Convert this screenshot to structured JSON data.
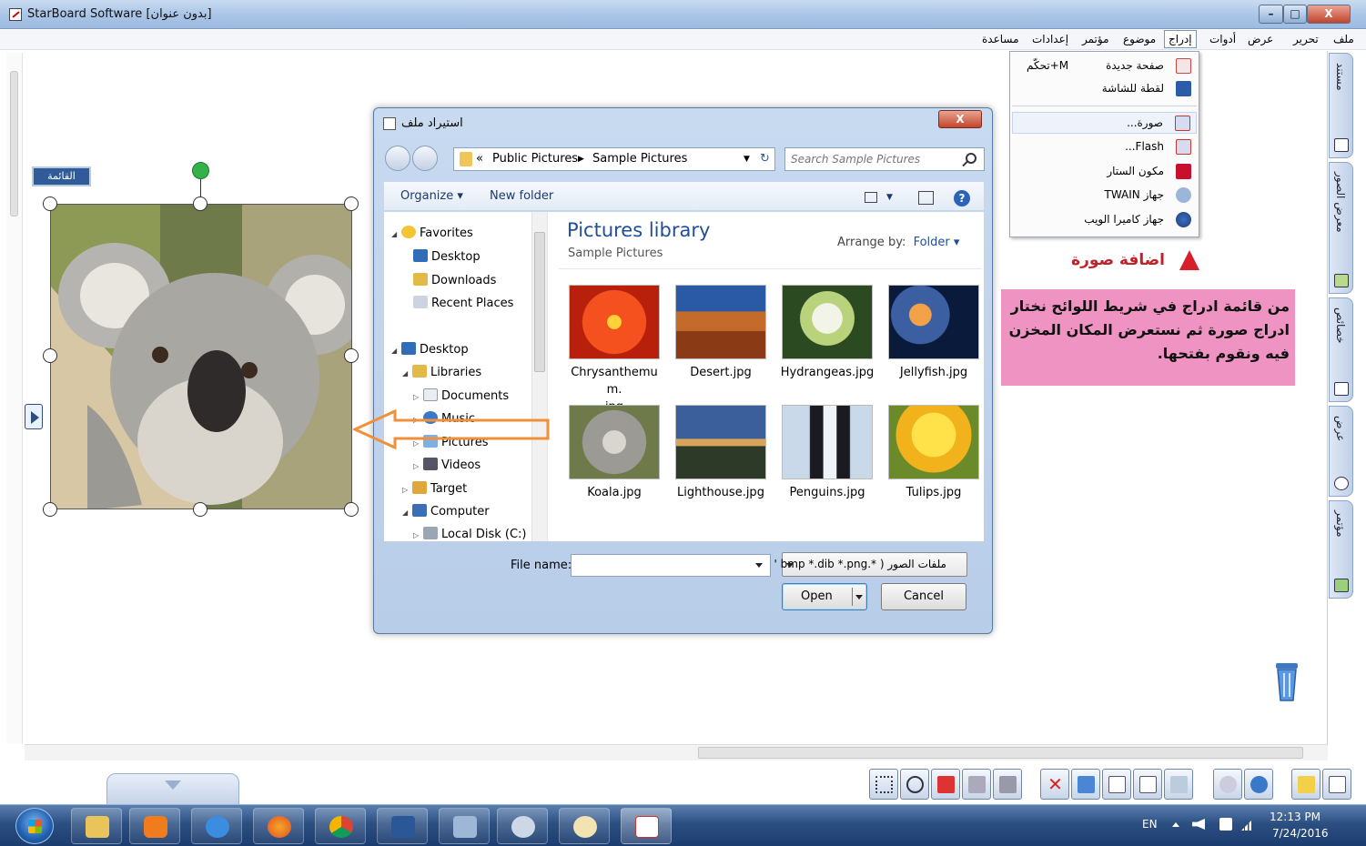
{
  "window": {
    "title": "StarBoard Software [بدون عنوان]",
    "controls": {
      "minimize": "–",
      "maximize": "□",
      "close": "X"
    }
  },
  "menubar": {
    "items": [
      "ملف",
      "تحرير",
      "عرض",
      "أدوات",
      "إدراج",
      "موضوع",
      "مؤتمر",
      "إعدادات",
      "مساعدة"
    ],
    "active": "إدراج"
  },
  "insert_menu": {
    "items": [
      {
        "label": "صفحة جديدة",
        "shortcut": "تحكّم+M",
        "icon": "new-page-icon"
      },
      {
        "label": "لقطة للشاشة",
        "shortcut": "",
        "icon": "screen-capture-icon"
      },
      {
        "label": "صورة...",
        "shortcut": "",
        "icon": "picture-icon",
        "highlighted": true
      },
      {
        "label": "Flash...",
        "shortcut": "",
        "icon": "flash-icon"
      },
      {
        "label": "مكون الستار",
        "shortcut": "",
        "icon": "star-component-icon"
      },
      {
        "label": "جهاز TWAIN",
        "shortcut": "",
        "icon": "twain-icon"
      },
      {
        "label": "جهاز كاميرا الويب",
        "shortcut": "",
        "icon": "webcam-icon"
      }
    ]
  },
  "annotation": {
    "caption": "اضافة صورة",
    "instruction_lines": [
      "من قائمة ادراج في شريط اللوائح نختار",
      "ادراج صورة ثم نستعرض المكان المخزن",
      "فيه ونقوم بفتحها."
    ]
  },
  "canvas": {
    "list_tab": "القائمة",
    "right_tabs": [
      "مستند",
      "معرض الصور",
      "خصائص",
      "عرض",
      "مؤتمر"
    ]
  },
  "dialog": {
    "title": "استيراد ملف",
    "close": "X",
    "breadcrumb": [
      "«",
      "Public Pictures",
      "Sample Pictures"
    ],
    "search_placeholder": "Search Sample Pictures",
    "toolbar": {
      "organize": "Organize ▾",
      "new_folder": "New folder"
    },
    "nav_tree": [
      {
        "label": "Favorites",
        "icon": "star-icon",
        "level": 0,
        "expander": "◢"
      },
      {
        "label": "Desktop",
        "icon": "desktop-icon",
        "level": 1,
        "expander": ""
      },
      {
        "label": "Downloads",
        "icon": "downloads-icon",
        "level": 1,
        "expander": ""
      },
      {
        "label": "Recent Places",
        "icon": "recent-places-icon",
        "level": 1,
        "expander": ""
      },
      {
        "label": "Desktop",
        "icon": "desktop-icon",
        "level": 0,
        "expander": "◢"
      },
      {
        "label": "Libraries",
        "icon": "libraries-icon",
        "level": 1,
        "expander": "◢"
      },
      {
        "label": "Documents",
        "icon": "documents-icon",
        "level": 2,
        "expander": "▷"
      },
      {
        "label": "Music",
        "icon": "music-icon",
        "level": 2,
        "expander": "▷"
      },
      {
        "label": "Pictures",
        "icon": "pictures-icon",
        "level": 2,
        "expander": "▷"
      },
      {
        "label": "Videos",
        "icon": "videos-icon",
        "level": 2,
        "expander": "▷"
      },
      {
        "label": "Target",
        "icon": "user-folder-icon",
        "level": 1,
        "expander": "▷"
      },
      {
        "label": "Computer",
        "icon": "computer-icon",
        "level": 1,
        "expander": "◢"
      },
      {
        "label": "Local Disk (C:)",
        "icon": "drive-icon",
        "level": 2,
        "expander": "▷"
      }
    ],
    "library": {
      "title": "Pictures library",
      "subtitle": "Sample Pictures",
      "arrange_label": "Arrange by:",
      "arrange_value": "Folder ▾"
    },
    "files": [
      {
        "name": "Chrysanthemum.jpg",
        "line1": "Chrysanthemum.",
        "line2": "jpg"
      },
      {
        "name": "Desert.jpg",
        "line1": "Desert.jpg",
        "line2": ""
      },
      {
        "name": "Hydrangeas.jpg",
        "line1": "Hydrangeas.jpg",
        "line2": ""
      },
      {
        "name": "Jellyfish.jpg",
        "line1": "Jellyfish.jpg",
        "line2": ""
      },
      {
        "name": "Koala.jpg",
        "line1": "Koala.jpg",
        "line2": ""
      },
      {
        "name": "Lighthouse.jpg",
        "line1": "Lighthouse.jpg",
        "line2": ""
      },
      {
        "name": "Penguins.jpg",
        "line1": "Penguins.jpg",
        "line2": ""
      },
      {
        "name": "Tulips.jpg",
        "line1": "Tulips.jpg",
        "line2": ""
      }
    ],
    "file_name_label": "File name:",
    "file_name_value": "",
    "filter": "ملفات الصور ( *.bmp *.dib *.png '",
    "open": "Open",
    "cancel": "Cancel"
  },
  "taskbar": {
    "apps": [
      "file-explorer-icon",
      "media-player-icon",
      "internet-explorer-icon",
      "firefox-icon",
      "chrome-icon",
      "word-icon",
      "screen-icon",
      "snipping-tool-icon",
      "paint-icon",
      "starboard-icon"
    ],
    "language": "EN",
    "time": "12:13 PM",
    "date": "7/24/2016"
  },
  "colors": {
    "accent_blue": "#1f4e9a",
    "caption_red": "#c0222b",
    "instruction_bg": "#ef93c2",
    "arrow_orange": "#f0903a"
  }
}
